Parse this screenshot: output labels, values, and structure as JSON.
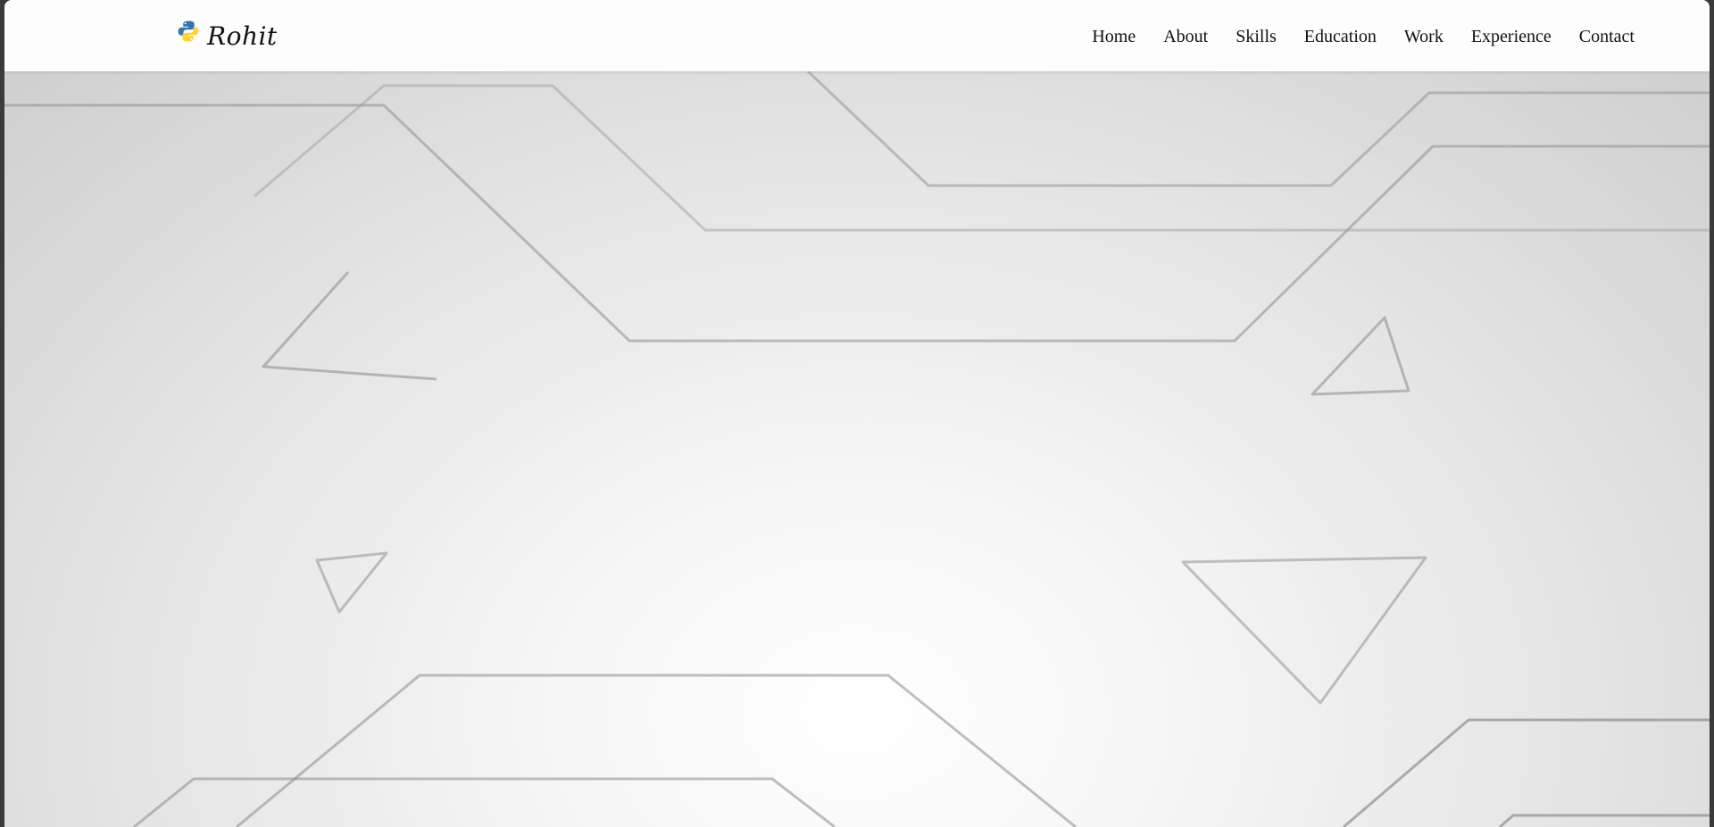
{
  "brand": {
    "name": "Rohit",
    "icon": "python-logo-icon"
  },
  "nav": {
    "items": [
      {
        "label": "Home"
      },
      {
        "label": "About"
      },
      {
        "label": "Skills"
      },
      {
        "label": "Education"
      },
      {
        "label": "Work"
      },
      {
        "label": "Experience"
      },
      {
        "label": "Contact"
      }
    ]
  },
  "colors": {
    "navbar_bg": "#fdfdfd",
    "hero_center": "#ffffff",
    "hero_edge": "#cfcfcf",
    "line_color": "#9a9a9a",
    "python_blue": "#3776ab",
    "python_yellow": "#ffd43b"
  }
}
